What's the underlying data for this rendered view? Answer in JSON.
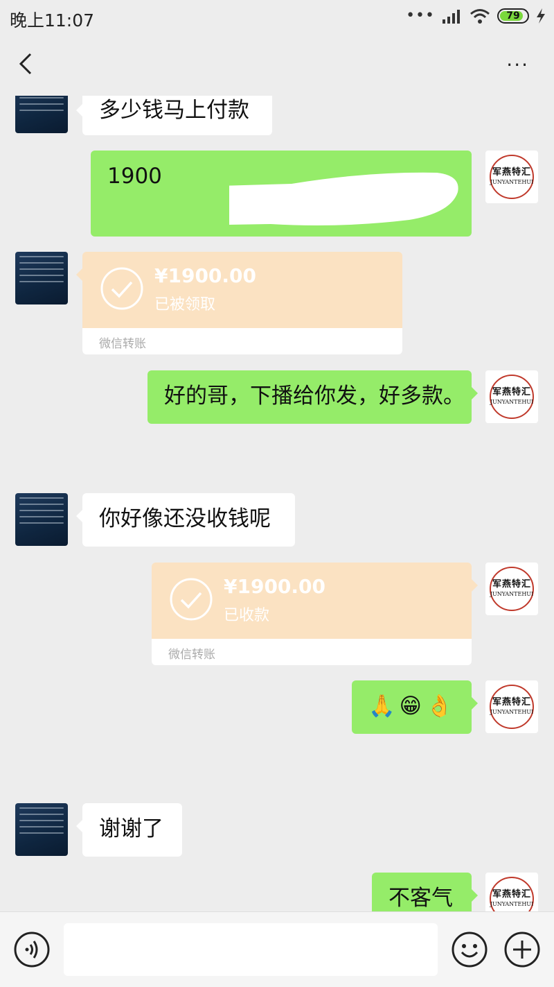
{
  "status_bar": {
    "time": "晚上11:07",
    "battery": "79",
    "icons": [
      "more-dots-icon",
      "signal-icon",
      "wifi-icon",
      "battery-icon",
      "charging-icon"
    ]
  },
  "nav": {
    "back_icon": "chevron-left-icon",
    "more_icon": "more-icon",
    "more": "···"
  },
  "messages": [
    {
      "type": "text",
      "side": "left",
      "text": "多少钱马上付款"
    },
    {
      "type": "text",
      "side": "right",
      "text": "1900",
      "redacted": true
    },
    {
      "type": "transfer",
      "side": "left",
      "amount": "¥1900.00",
      "status": "已被领取",
      "label": "微信转账"
    },
    {
      "type": "text",
      "side": "right",
      "text": "好的哥，下播给你发，好多款。"
    },
    {
      "type": "text",
      "side": "left",
      "text": "你好像还没收钱呢"
    },
    {
      "type": "transfer",
      "side": "right",
      "amount": "¥1900.00",
      "status": "已收款",
      "label": "微信转账"
    },
    {
      "type": "emoji",
      "side": "right",
      "emojis": [
        "🙏",
        "😁",
        "👌"
      ]
    },
    {
      "type": "text",
      "side": "left",
      "text": "谢谢了"
    },
    {
      "type": "text",
      "side": "right",
      "text": "不客气"
    }
  ],
  "avatar_right": {
    "cn": "军燕特汇",
    "en": "JUNYANTEHUI"
  },
  "input_bar": {
    "voice_icon": "voice-icon",
    "emoji_icon": "emoji-icon",
    "plus_icon": "plus-icon"
  },
  "colors": {
    "background": "#ededed",
    "outgoing_bubble": "#95ec69",
    "incoming_bubble": "#ffffff",
    "transfer": "#fbe2c2"
  }
}
